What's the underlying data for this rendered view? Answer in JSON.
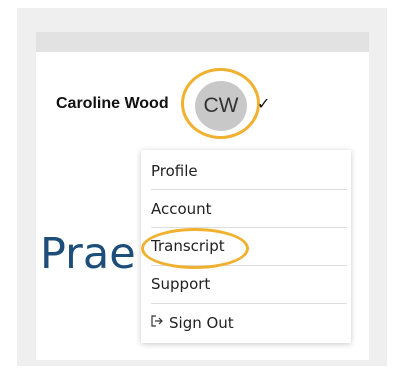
{
  "header": {
    "user_name": "Caroline Wood",
    "avatar_initials": "CW",
    "chevron": "✓"
  },
  "page": {
    "heading_partial": "Prae"
  },
  "menu": {
    "items": [
      {
        "label": "Profile",
        "icon": ""
      },
      {
        "label": "Account",
        "icon": ""
      },
      {
        "label": "Transcript",
        "icon": ""
      },
      {
        "label": "Support",
        "icon": ""
      },
      {
        "label": "Sign Out",
        "icon": "sign-out-icon"
      }
    ]
  },
  "colors": {
    "highlight": "#f0b030",
    "heading": "#1d4d79",
    "avatar_bg": "#c8c8c8"
  }
}
